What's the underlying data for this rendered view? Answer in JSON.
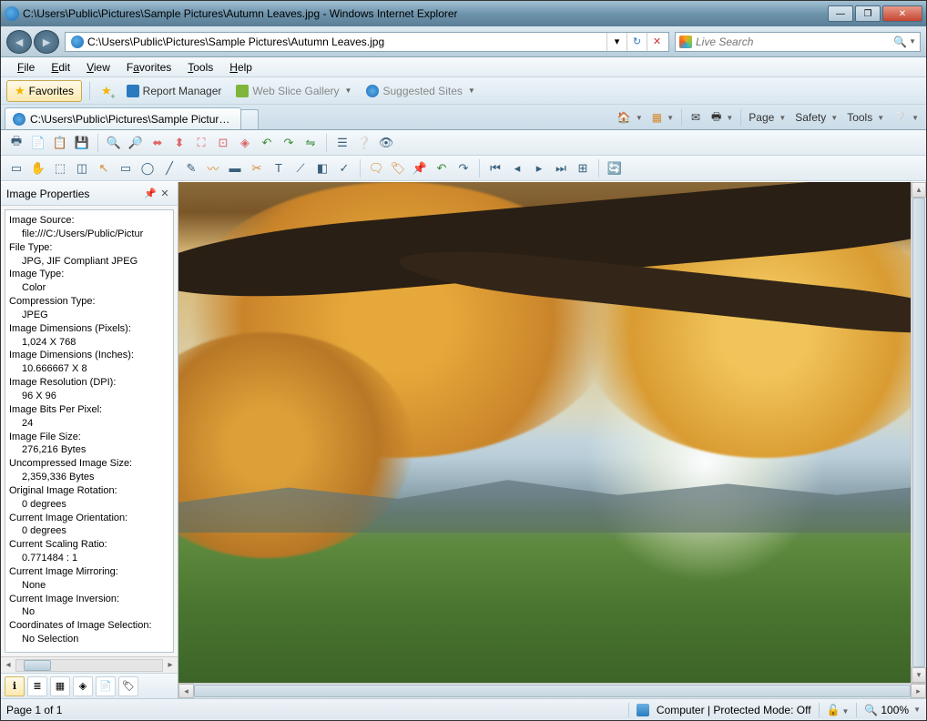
{
  "window": {
    "title": "C:\\Users\\Public\\Pictures\\Sample Pictures\\Autumn Leaves.jpg - Windows Internet Explorer"
  },
  "address": {
    "url": "C:\\Users\\Public\\Pictures\\Sample Pictures\\Autumn Leaves.jpg"
  },
  "search": {
    "placeholder": "Live Search"
  },
  "menu": {
    "file": "File",
    "edit": "Edit",
    "view": "View",
    "favorites": "Favorites",
    "tools": "Tools",
    "help": "Help"
  },
  "favbar": {
    "favorites": "Favorites",
    "report_manager": "Report Manager",
    "web_slice": "Web Slice Gallery",
    "suggested": "Suggested Sites"
  },
  "tab": {
    "label": "C:\\Users\\Public\\Pictures\\Sample Pictures\\Autum..."
  },
  "commandbar": {
    "page": "Page",
    "safety": "Safety",
    "tools": "Tools"
  },
  "panel": {
    "title": "Image Properties",
    "props": [
      {
        "label": "Image Source:",
        "value": "file:///C:/Users/Public/Pictur"
      },
      {
        "label": "File Type:",
        "value": "JPG, JIF Compliant JPEG"
      },
      {
        "label": "Image Type:",
        "value": "Color"
      },
      {
        "label": "Compression Type:",
        "value": "JPEG"
      },
      {
        "label": "Image Dimensions (Pixels):",
        "value": "1,024 X 768"
      },
      {
        "label": "Image Dimensions (Inches):",
        "value": "10.666667 X 8"
      },
      {
        "label": "Image Resolution (DPI):",
        "value": "96 X 96"
      },
      {
        "label": "Image Bits Per Pixel:",
        "value": "24"
      },
      {
        "label": "Image File Size:",
        "value": "276,216 Bytes"
      },
      {
        "label": "Uncompressed Image Size:",
        "value": "2,359,336 Bytes"
      },
      {
        "label": "Original Image Rotation:",
        "value": "0 degrees"
      },
      {
        "label": "Current Image Orientation:",
        "value": "0 degrees"
      },
      {
        "label": "Current Scaling Ratio:",
        "value": "0.771484 : 1"
      },
      {
        "label": "Current Image Mirroring:",
        "value": "None"
      },
      {
        "label": "Current Image Inversion:",
        "value": "No"
      },
      {
        "label": "Coordinates of Image Selection:",
        "value": "No Selection"
      }
    ]
  },
  "status": {
    "page": "Page 1 of 1",
    "zone": "Computer | Protected Mode: Off",
    "zoom": "100%"
  }
}
